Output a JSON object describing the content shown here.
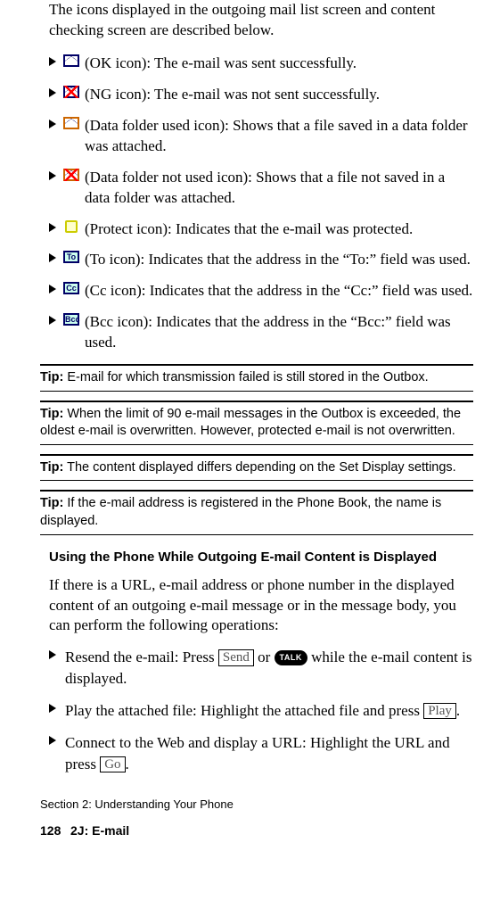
{
  "intro": "The icons displayed in the outgoing mail list screen and content checking screen are described below.",
  "iconList": [
    {
      "label": "(OK icon): The e-mail was sent successfully."
    },
    {
      "label": "(NG icon): The e-mail was not sent successfully."
    },
    {
      "label": "(Data folder used icon): Shows that a file saved in a data folder was attached."
    },
    {
      "label": "(Data folder not used icon): Shows that a file not saved in a data folder was attached."
    },
    {
      "label": "(Protect icon): Indicates that the e-mail was protected."
    },
    {
      "label": "(To icon): Indicates that the address in the “To:” field was used."
    },
    {
      "label": "(Cc icon): Indicates that the address in the “Cc:” field was used."
    },
    {
      "label": "(Bcc icon): Indicates that the address in the “Bcc:” field was used."
    }
  ],
  "iconTags": {
    "to": "To",
    "cc": "Cc",
    "bcc": "Bcc"
  },
  "tips": {
    "label": "Tip:",
    "t1": "E-mail for which transmission failed is still stored in the Outbox.",
    "t2": "When the limit of 90 e-mail messages in the Outbox is exceeded, the oldest e-mail is overwritten. However, protected e-mail is not overwritten.",
    "t3": "The content displayed differs depending on the Set Display settings.",
    "t4": "If the e-mail address is registered in the Phone Book, the name is displayed."
  },
  "subhead": "Using the Phone While Outgoing E-mail Content is Displayed",
  "usingIntro": "If there is a URL, e-mail address or phone number in the displayed content of an outgoing e-mail message or in the message body, you can perform the following operations:",
  "ops": {
    "resend_a": "Resend the e-mail: Press ",
    "send_btn": "Send",
    "resend_b": " or ",
    "talk_btn": "TALK",
    "resend_c": " while the e-mail content is displayed.",
    "play_a": "Play the attached file: Highlight the attached file and press ",
    "play_btn": "Play",
    "play_b": ".",
    "web_a": "Connect to the Web and display a URL: Highlight the URL and press ",
    "go_btn": "Go",
    "web_b": "."
  },
  "footer": {
    "section": "Section 2: Understanding Your Phone",
    "page": "128",
    "chapter": "2J: E-mail"
  }
}
